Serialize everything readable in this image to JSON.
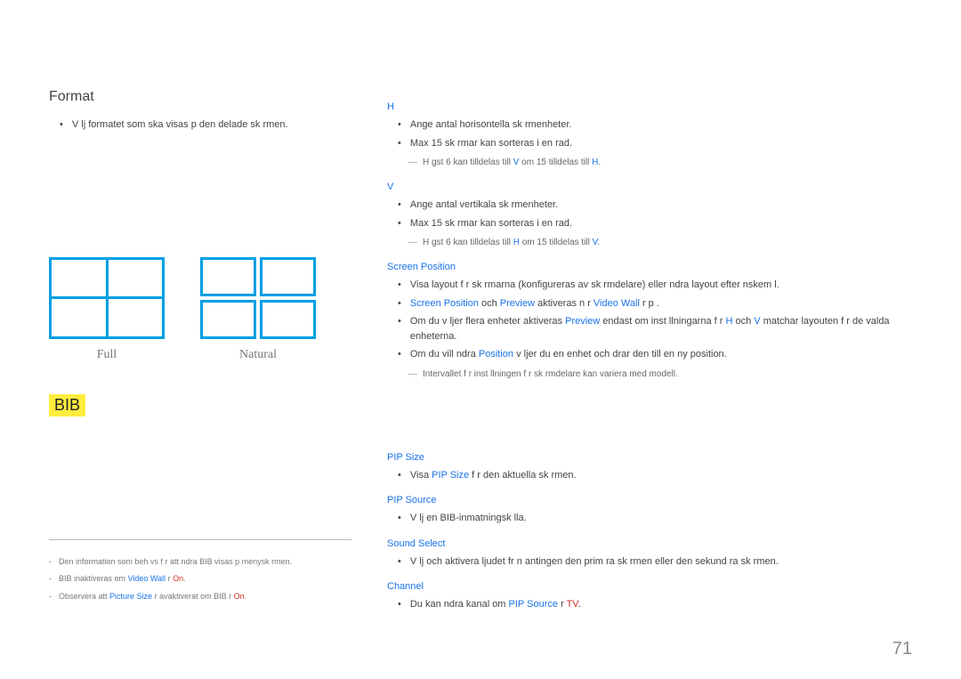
{
  "left": {
    "heading": "Format",
    "bullet": "V lj formatet som ska visas p  den delade sk rmen.",
    "diag_full": "Full",
    "diag_natural": "Natural",
    "bib": "BIB"
  },
  "footnotes": {
    "f1_a": "Den information som beh vs f r att  ndra BIB visas p  menysk rmen.",
    "f2_a": "BIB inaktiveras om ",
    "f2_b": "Video Wall",
    "f2_c": "  r ",
    "f2_d": "On",
    "f2_e": ".",
    "f3_a": "Observera att ",
    "f3_b": "Picture Size",
    "f3_c": "  r avaktiverat om BIB  r ",
    "f3_d": "On",
    "f3_e": "."
  },
  "right": {
    "h_label": "H",
    "h_b1": "Ange antal horisontella sk rmenheter.",
    "h_b2": "Max 15 sk rmar kan sorteras i en rad.",
    "h_note_a": "H gst 6 kan tilldelas till ",
    "h_note_b": "V",
    "h_note_c": " om 15 tilldelas till ",
    "h_note_d": "H",
    "h_note_e": ".",
    "v_label": "V",
    "v_b1": "Ange antal vertikala sk rmenheter.",
    "v_b2": "Max 15 sk rmar kan sorteras i en rad.",
    "v_note_a": "H gst 6 kan tilldelas till ",
    "v_note_b": "H",
    "v_note_c": " om 15 tilldelas till ",
    "v_note_d": "V",
    "v_note_e": ".",
    "sp_label": "Screen Position",
    "sp_b1": "Visa layout f r sk rmarna (konfigureras av sk rmdelare) eller  ndra layout efter  nskem l.",
    "sp_b2_a": "Screen Position",
    "sp_b2_b": " och ",
    "sp_b2_c": "Preview",
    "sp_b2_d": " aktiveras n r ",
    "sp_b2_e": "Video Wall",
    "sp_b2_f": "  r p .",
    "sp_b3_a": "Om du v ljer flera enheter aktiveras ",
    "sp_b3_b": "Preview",
    "sp_b3_c": " endast om inst llningarna f r ",
    "sp_b3_d": "H",
    "sp_b3_e": " och ",
    "sp_b3_f": "V",
    "sp_b3_g": " matchar layouten f r de valda enheterna.",
    "sp_b4_a": "Om du vill  ndra ",
    "sp_b4_b": "Position",
    "sp_b4_c": " v ljer du en enhet och drar den till en ny position.",
    "sp_note": "Intervallet f r inst llningen f r sk rmdelare kan variera med modell.",
    "pip_size_label": "PIP Size",
    "pip_size_a": "Visa ",
    "pip_size_b": "PIP Size",
    "pip_size_c": " f r den aktuella sk rmen.",
    "pip_src_label": "PIP Source",
    "pip_src_b1": "V lj en BIB-inmatningsk lla.",
    "sound_label": "Sound Select",
    "sound_b1": "V lj och aktivera ljudet fr n antingen den prim ra sk rmen eller den sekund ra sk rmen.",
    "channel_label": "Channel",
    "channel_a": "Du kan  ndra kanal om ",
    "channel_b": "PIP Source",
    "channel_c": "  r ",
    "channel_d": "TV",
    "channel_e": "."
  },
  "page_number": "71"
}
